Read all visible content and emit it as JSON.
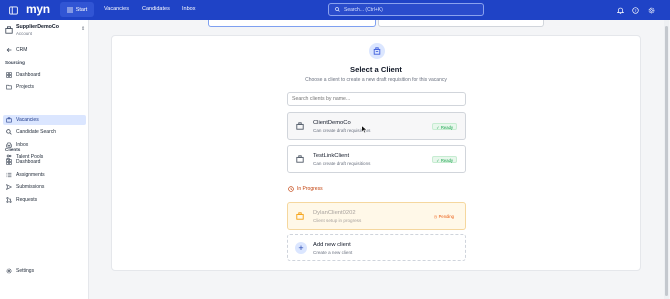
{
  "topbar": {
    "brand": "myn",
    "nav": [
      {
        "label": "Start",
        "active": true
      },
      {
        "label": "Vacancies",
        "active": false
      },
      {
        "label": "Candidates",
        "active": false
      },
      {
        "label": "Inbox",
        "active": false
      }
    ],
    "search_label": "Search... (Ctrl+K)",
    "right_icons": [
      "bell-icon",
      "help-icon",
      "settings-icon"
    ]
  },
  "sidebar": {
    "account": {
      "name": "SupplierDemoCo",
      "sub": "Account"
    },
    "crm_label": "CRM",
    "sourcing_title": "Sourcing",
    "sourcing_items": [
      {
        "label": "Dashboard",
        "icon": "grid-icon"
      },
      {
        "label": "Projects",
        "icon": "folder-icon"
      },
      {
        "label": "Vacancies",
        "icon": "briefcase-icon",
        "active": true
      },
      {
        "label": "Candidate Search",
        "icon": "search-icon"
      },
      {
        "label": "Inbox",
        "icon": "inbox-icon"
      },
      {
        "label": "Talent Pools",
        "icon": "users-icon"
      }
    ],
    "clients_title": "Clients",
    "clients_items": [
      {
        "label": "Dashboard",
        "icon": "grid-icon"
      },
      {
        "label": "Assignments",
        "icon": "list-icon"
      },
      {
        "label": "Submissions",
        "icon": "send-icon"
      },
      {
        "label": "Requests",
        "icon": "git-pull-icon"
      }
    ],
    "settings_label": "Settings"
  },
  "main": {
    "title": "Select a Client",
    "subtitle": "Choose a client to create a new draft requisition for this vacancy",
    "search_placeholder": "Search clients by name...",
    "clients": [
      {
        "name": "ClientDemoCo",
        "desc": "Can create draft requisitions",
        "status": "Ready"
      },
      {
        "name": "TestLinkClient",
        "desc": "Can create draft requisitions",
        "status": "Ready"
      }
    ],
    "in_progress_title": "In Progress",
    "pending_client": {
      "name": "DylanClient0202",
      "desc": "Client setup in progress",
      "status": "Pending"
    },
    "add_client": {
      "name": "Add new client",
      "desc": "Create a new client"
    }
  },
  "colors": {
    "brand": "#1f43c6",
    "accent_light": "#dbe6ff",
    "ready": "#16a34a",
    "pending": "#ea580c"
  }
}
